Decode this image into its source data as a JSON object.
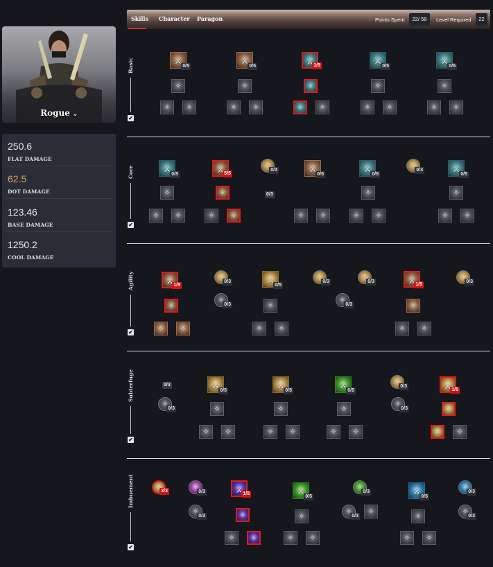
{
  "character": {
    "class_name": "Rogue",
    "dropdown_icon": "chevron-down-icon"
  },
  "stats": [
    {
      "value": "250.6",
      "label": "FLAT DAMAGE",
      "color": "#e8e8ee"
    },
    {
      "value": "62.5",
      "label": "DOT DAMAGE",
      "color": "#d8a35a"
    },
    {
      "value": "123.46",
      "label": "BASE DAMAGE",
      "color": "#e8e8ee"
    },
    {
      "value": "1250.2",
      "label": "COOL DAMAGE",
      "color": "#e8e8ee"
    }
  ],
  "tabs": [
    {
      "label": "Skills",
      "active": true
    },
    {
      "label": "Character",
      "active": false
    },
    {
      "label": "Paragon",
      "active": false
    }
  ],
  "summary": {
    "points_spent_label": "Points Spent",
    "points_spent_value": "22/ 58",
    "level_required_label": "Level Required",
    "level_required_value": "22"
  },
  "accent_color": "#e01c1c",
  "sections": [
    {
      "title": "Basic",
      "skills": [
        {
          "c": "brown",
          "big": true,
          "n": "0/5"
        },
        {
          "c": "brown",
          "big": true,
          "n": "0/5"
        },
        {
          "c": "teal",
          "big": true,
          "n": "1/5",
          "sel": true,
          "red": true
        },
        {
          "c": "teal",
          "big": true,
          "n": "0/5"
        },
        {
          "c": "teal",
          "big": true,
          "n": "0/5"
        },
        {
          "c": "gray"
        },
        {
          "c": "gray"
        },
        {
          "c": "teal",
          "sel": true
        },
        {
          "c": "gray"
        },
        {
          "c": "gray"
        },
        {
          "c": "gray"
        },
        {
          "c": "gray"
        },
        {
          "c": "gray"
        },
        {
          "c": "gray"
        },
        {
          "c": "teal",
          "sel": true
        },
        {
          "c": "gray"
        },
        {
          "c": "gray"
        },
        {
          "c": "gray"
        },
        {
          "c": "gray"
        },
        {
          "c": "gray"
        }
      ]
    },
    {
      "title": "Core",
      "skills": [
        {
          "c": "teal",
          "big": true,
          "n": "0/5"
        },
        {
          "c": "brown",
          "big": true,
          "n": "5/5",
          "sel": true,
          "red": true
        },
        {
          "c": "gold",
          "round": true,
          "n": "0/3"
        },
        {
          "c": "brown",
          "big": true,
          "n": "0/5"
        },
        {
          "c": "teal",
          "big": true,
          "n": "0/5"
        },
        {
          "c": "gold",
          "round": true,
          "n": "0/3"
        },
        {
          "c": "teal",
          "big": true,
          "n": "0/5"
        },
        {
          "c": "gray"
        },
        {
          "c": "brown",
          "sel": true
        },
        {
          "c": "gray"
        },
        {
          "c": "gray"
        },
        {
          "c": "gray"
        },
        {
          "c": "gray"
        },
        {
          "c": "gray"
        },
        {
          "c": "brown",
          "sel": true
        },
        {
          "c": "gray"
        },
        {
          "c": "gray"
        },
        {
          "c": "gray"
        },
        {
          "c": "gray"
        },
        {
          "c": "gray"
        },
        {
          "c": "gray"
        },
        {
          "c": "gray"
        }
      ],
      "loose_counts": [
        "0/3"
      ]
    },
    {
      "title": "Agility",
      "skills": [
        {
          "c": "brown",
          "big": true,
          "n": "1/5",
          "sel": true,
          "red": true
        },
        {
          "c": "gold",
          "round": true,
          "n": "0/3"
        },
        {
          "c": "gold",
          "big": true,
          "n": "0/5"
        },
        {
          "c": "gold",
          "round": true,
          "n": "0/3"
        },
        {
          "c": "gold",
          "round": true,
          "n": "0/3"
        },
        {
          "c": "brown",
          "big": true,
          "n": "1/5",
          "sel": true,
          "red": true
        },
        {
          "c": "gold",
          "round": true,
          "n": "0/3"
        },
        {
          "c": "brown",
          "sel": true
        },
        {
          "c": "gray",
          "round": true,
          "n": "0/3"
        },
        {
          "c": "gray"
        },
        {
          "c": "gray",
          "round": true,
          "n": "0/3"
        },
        {
          "c": "brown"
        },
        {
          "c": "brown"
        },
        {
          "c": "brown"
        },
        {
          "c": "gray"
        },
        {
          "c": "gray"
        },
        {
          "c": "gray"
        },
        {
          "c": "gray"
        }
      ]
    },
    {
      "title": "Subterfuge",
      "skills": [
        {
          "c": "gold",
          "big": true,
          "n": "0/5"
        },
        {
          "c": "gold",
          "big": true,
          "n": "0/5"
        },
        {
          "c": "green",
          "big": true,
          "n": "0/5"
        },
        {
          "c": "gold",
          "round": true,
          "n": "0/3"
        },
        {
          "c": "gold",
          "big": true,
          "n": "1/5",
          "sel": true,
          "red": true
        },
        {
          "c": "gray",
          "round": true,
          "n": "0/3"
        },
        {
          "c": "gray"
        },
        {
          "c": "gray"
        },
        {
          "c": "gray"
        },
        {
          "c": "gray",
          "round": true,
          "n": "0/3"
        },
        {
          "c": "gold",
          "sel": true
        },
        {
          "c": "gray"
        },
        {
          "c": "gray"
        },
        {
          "c": "gray"
        },
        {
          "c": "gray"
        },
        {
          "c": "gray"
        },
        {
          "c": "gray"
        },
        {
          "c": "gold",
          "sel": true
        },
        {
          "c": "gray"
        }
      ],
      "loose_counts": [
        "0/3"
      ]
    },
    {
      "title": "Imbuement",
      "skills": [
        {
          "c": "gold",
          "round": true,
          "n": "3/3",
          "sel": true,
          "red": true
        },
        {
          "c": "pink",
          "round": true,
          "n": "0/3"
        },
        {
          "c": "purple",
          "big": true,
          "n": "1/5",
          "sel": true,
          "red": true
        },
        {
          "c": "green",
          "big": true,
          "n": "0/5"
        },
        {
          "c": "green",
          "round": true,
          "n": "0/3"
        },
        {
          "c": "blue",
          "big": true,
          "n": "0/5"
        },
        {
          "c": "blue",
          "round": true,
          "n": "0/3"
        },
        {
          "c": "gray",
          "round": true,
          "n": "0/3"
        },
        {
          "c": "purple",
          "sel": true
        },
        {
          "c": "gray"
        },
        {
          "c": "gray",
          "round": true,
          "n": "0/3"
        },
        {
          "c": "gray"
        },
        {
          "c": "gray"
        },
        {
          "c": "gray",
          "round": true,
          "n": "0/3"
        },
        {
          "c": "gray"
        },
        {
          "c": "purple",
          "sel": true
        },
        {
          "c": "gray"
        },
        {
          "c": "gray"
        },
        {
          "c": "gray"
        },
        {
          "c": "gray"
        }
      ]
    }
  ]
}
